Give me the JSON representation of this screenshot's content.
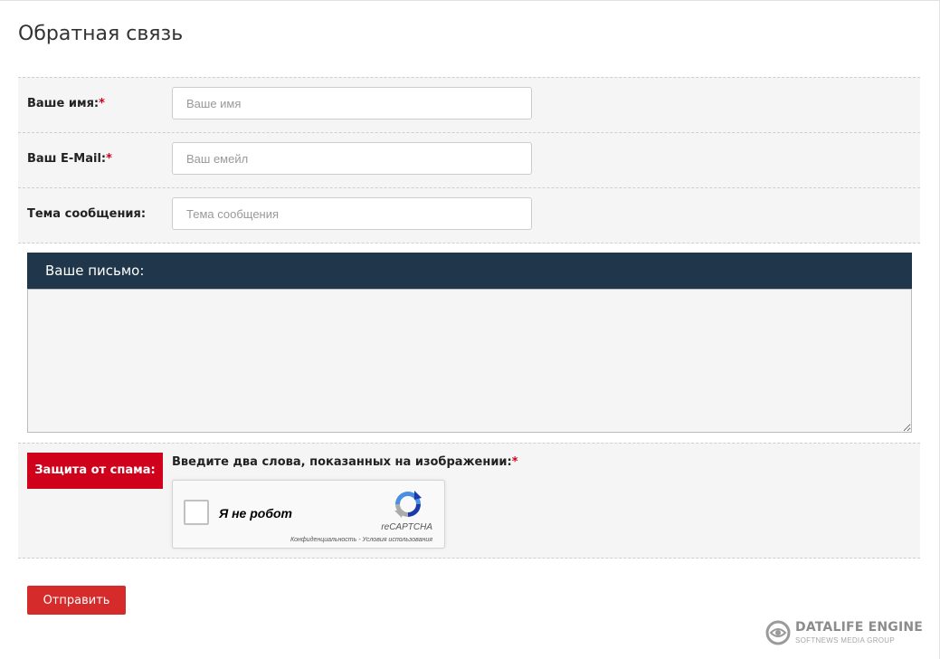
{
  "page": {
    "title": "Обратная связь"
  },
  "form": {
    "name": {
      "label": "Ваше имя:",
      "required_mark": "*",
      "placeholder": "Ваше имя",
      "value": ""
    },
    "email": {
      "label": "Ваш E-Mail:",
      "required_mark": "*",
      "placeholder": "Ваш емейл",
      "value": ""
    },
    "subject": {
      "label": "Тема сообщения:",
      "placeholder": "Тема сообщения",
      "value": ""
    },
    "message": {
      "header": "Ваше письмо:",
      "value": ""
    },
    "spam": {
      "badge": "Защита от спама:",
      "prompt": "Введите два слова, показанных на изображении:",
      "required_mark": "*"
    },
    "recaptcha": {
      "label": "Я не робот",
      "brand": "reCAPTCHA",
      "links": "Конфиденциальность - Условия использования",
      "checked": false
    },
    "submit_label": "Отправить"
  },
  "footer": {
    "logo_title": "DATALIFE ENGINE",
    "logo_subtitle": "SOFTNEWS MEDIA GROUP"
  },
  "colors": {
    "accent_red": "#d62b2b",
    "badge_red": "#d0021b",
    "header_navy": "#20364a",
    "row_bg": "#f5f5f5"
  },
  "icons": {
    "recaptcha": "recaptcha-logo-icon",
    "datalife": "datalife-engine-logo-icon"
  }
}
